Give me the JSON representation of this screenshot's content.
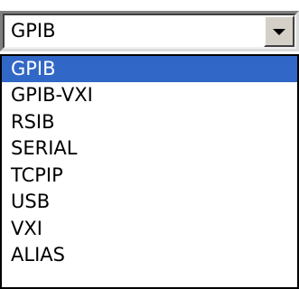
{
  "combo": {
    "selected_value": "GPIB",
    "button_icon": "chevron-down-icon"
  },
  "dropdown": {
    "items": [
      {
        "label": "GPIB",
        "selected": true
      },
      {
        "label": "GPIB-VXI",
        "selected": false
      },
      {
        "label": "RSIB",
        "selected": false
      },
      {
        "label": "SERIAL",
        "selected": false
      },
      {
        "label": "TCPIP",
        "selected": false
      },
      {
        "label": "USB",
        "selected": false
      },
      {
        "label": "VXI",
        "selected": false
      },
      {
        "label": "ALIAS",
        "selected": false
      }
    ]
  },
  "colors": {
    "selection_background": "#3167c6",
    "selection_text": "#ffffff",
    "button_face": "#d4d0c8"
  }
}
